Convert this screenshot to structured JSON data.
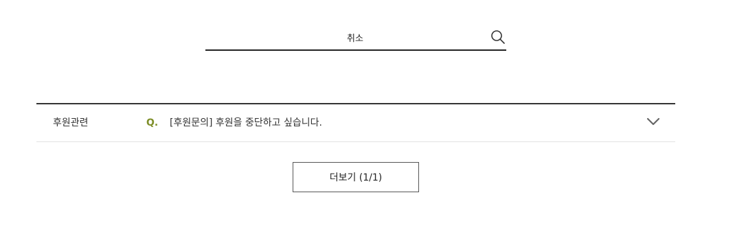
{
  "search": {
    "value": "취소",
    "icon": "search-icon"
  },
  "faq": {
    "items": [
      {
        "category": "후원관련",
        "q_marker": "Q.",
        "question": "[후원문의] 후원을 중단하고 싶습니다.",
        "icon": "chevron-down-icon"
      }
    ]
  },
  "more": {
    "label": "더보기 (1/1)"
  },
  "colors": {
    "accent_q": "#7f8f2a",
    "divider": "#333333",
    "row_border": "#e2e2e2"
  }
}
